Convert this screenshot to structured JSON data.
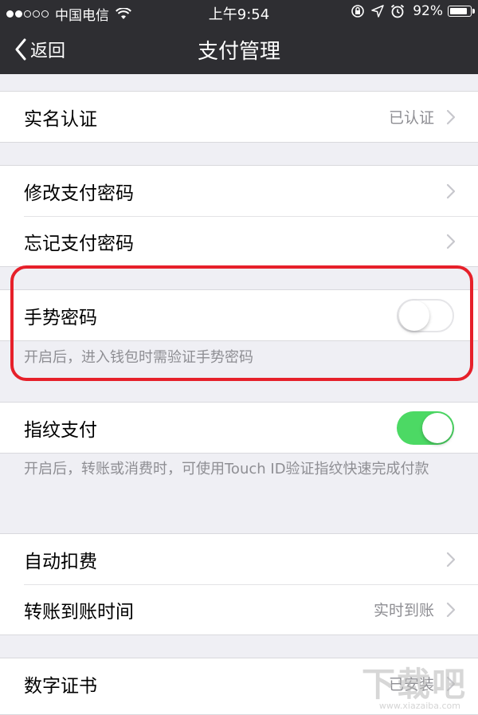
{
  "status_bar": {
    "carrier": "中国电信",
    "time": "上午9:54",
    "battery": "92%",
    "battery_level": 0.92,
    "icons": [
      "signal-dots",
      "wifi-icon",
      "rotation-lock-icon",
      "location-icon",
      "alarm-icon",
      "battery-icon"
    ]
  },
  "nav": {
    "back_label": "返回",
    "title": "支付管理"
  },
  "groups": {
    "verify": {
      "label": "实名认证",
      "value": "已认证"
    },
    "password": {
      "items": [
        {
          "label": "修改支付密码"
        },
        {
          "label": "忘记支付密码"
        }
      ]
    },
    "gesture": {
      "label": "手势密码",
      "enabled": false,
      "note": "开启后，进入钱包时需验证手势密码"
    },
    "fingerprint": {
      "label": "指纹支付",
      "enabled": true,
      "note": "开启后，转账或消费时，可使用Touch ID验证指纹快速完成付款"
    },
    "payments": {
      "items": [
        {
          "label": "自动扣费",
          "value": ""
        },
        {
          "label": "转账到账时间",
          "value": "实时到账"
        }
      ]
    },
    "certificate": {
      "label": "数字证书",
      "value": "已安装"
    }
  },
  "watermark": {
    "text": "下载吧",
    "sub": "www.xiazaiba.com"
  },
  "colors": {
    "nav_bg": "#2e2e32",
    "toggle_on": "#4cd964",
    "highlight": "#e6202a",
    "page_bg": "#efeff4"
  }
}
